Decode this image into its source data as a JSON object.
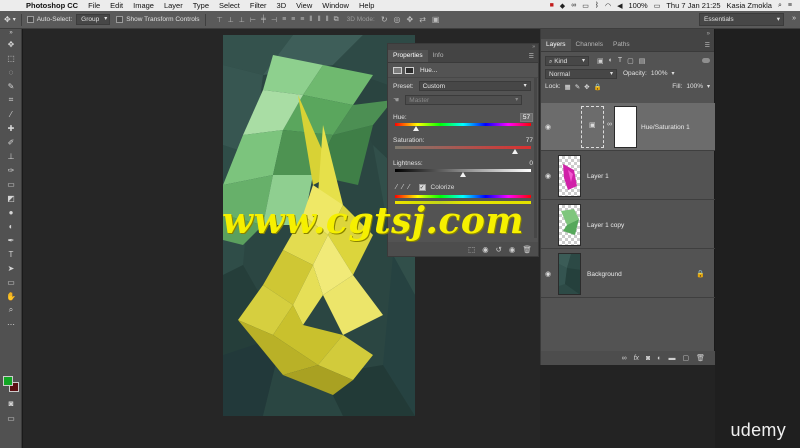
{
  "menubar": {
    "app": "Photoshop CC",
    "items": [
      "File",
      "Edit",
      "Image",
      "Layer",
      "Type",
      "Select",
      "Filter",
      "3D",
      "View",
      "Window",
      "Help"
    ],
    "battery": "100%",
    "datetime": "Thu 7 Jan  21:25",
    "user": "Kasia Zmokla"
  },
  "options": {
    "auto_select_label": "Auto-Select:",
    "auto_select_value": "Group",
    "show_transform_label": "Show Transform Controls",
    "mode3d_label": "3D Mode:",
    "workspace": "Essentials"
  },
  "properties": {
    "tabs": [
      "Properties",
      "Info"
    ],
    "adjustment": "Hue...",
    "preset_label": "Preset:",
    "preset_value": "Custom",
    "channel_value": "Master",
    "hue_label": "Hue:",
    "hue_value": "57",
    "saturation_label": "Saturation:",
    "saturation_value": "77",
    "lightness_label": "Lightness:",
    "lightness_value": "0",
    "colorize_label": "Colorize",
    "hue_pos": 0.158,
    "saturation_pos": 0.885,
    "lightness_pos": 0.5
  },
  "layers": {
    "tabs": [
      "Layers",
      "Channels",
      "Paths"
    ],
    "filter_label": "Kind",
    "blend_mode": "Normal",
    "opacity_label": "Opacity:",
    "opacity_value": "100%",
    "lock_label": "Lock:",
    "fill_label": "Fill:",
    "fill_value": "100%",
    "rows": [
      {
        "name": "Hue/Saturation 1"
      },
      {
        "name": "Layer 1"
      },
      {
        "name": "Layer 1 copy"
      },
      {
        "name": "Background"
      }
    ]
  },
  "watermark": "www.cgtsj.com",
  "brand": "udemy"
}
